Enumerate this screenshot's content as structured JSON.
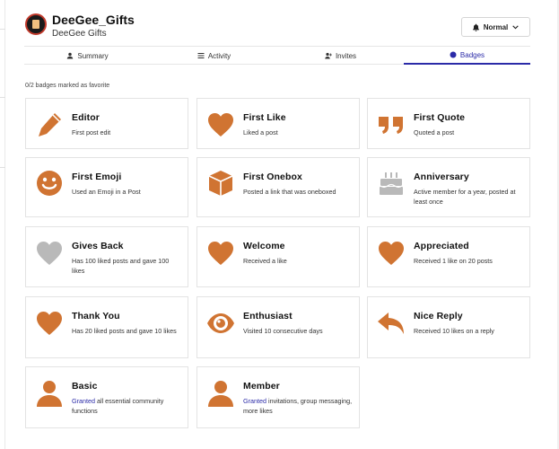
{
  "user": {
    "username": "DeeGee_Gifts",
    "full_name": "DeeGee Gifts",
    "notification_level": "Normal"
  },
  "tabs": [
    {
      "label": "Summary",
      "icon": "user-icon"
    },
    {
      "label": "Activity",
      "icon": "list-icon"
    },
    {
      "label": "Invites",
      "icon": "user-plus-icon"
    },
    {
      "label": "Badges",
      "icon": "badge-icon",
      "active": true
    }
  ],
  "favorites_text": "0/2 badges marked as favorite",
  "colors": {
    "badge_bronze": "#d07432",
    "badge_gray": "#b9b9b9",
    "accent": "#2b2ba8"
  },
  "badges": [
    {
      "title": "Editor",
      "description": "First post edit",
      "icon": "pencil-icon"
    },
    {
      "title": "First Like",
      "description": "Liked a post",
      "icon": "heart-icon"
    },
    {
      "title": "First Quote",
      "description": "Quoted a post",
      "icon": "quote-icon"
    },
    {
      "title": "First Emoji",
      "description": "Used an Emoji in a Post",
      "icon": "smiley-icon"
    },
    {
      "title": "First Onebox",
      "description": "Posted a link that was oneboxed",
      "icon": "cube-icon"
    },
    {
      "title": "Anniversary",
      "description": "Active member for a year, posted at least once",
      "icon": "cake-icon"
    },
    {
      "title": "Gives Back",
      "description": "Has 100 liked posts and gave 100 likes",
      "icon": "heart-icon"
    },
    {
      "title": "Welcome",
      "description": "Received a like",
      "icon": "heart-icon"
    },
    {
      "title": "Appreciated",
      "description": "Received 1 like on 20 posts",
      "icon": "heart-icon"
    },
    {
      "title": "Thank You",
      "description": "Has 20 liked posts and gave 10 likes",
      "icon": "heart-icon"
    },
    {
      "title": "Enthusiast",
      "description": "Visited 10 consecutive days",
      "icon": "eye-icon"
    },
    {
      "title": "Nice Reply",
      "description": "Received 10 likes on a reply",
      "icon": "reply-icon"
    },
    {
      "title": "Basic",
      "link_text": "Granted",
      "description": " all essential community functions",
      "icon": "person-icon"
    },
    {
      "title": "Member",
      "link_text": "Granted",
      "description": " invitations, group messaging, more likes",
      "icon": "person-icon"
    }
  ]
}
